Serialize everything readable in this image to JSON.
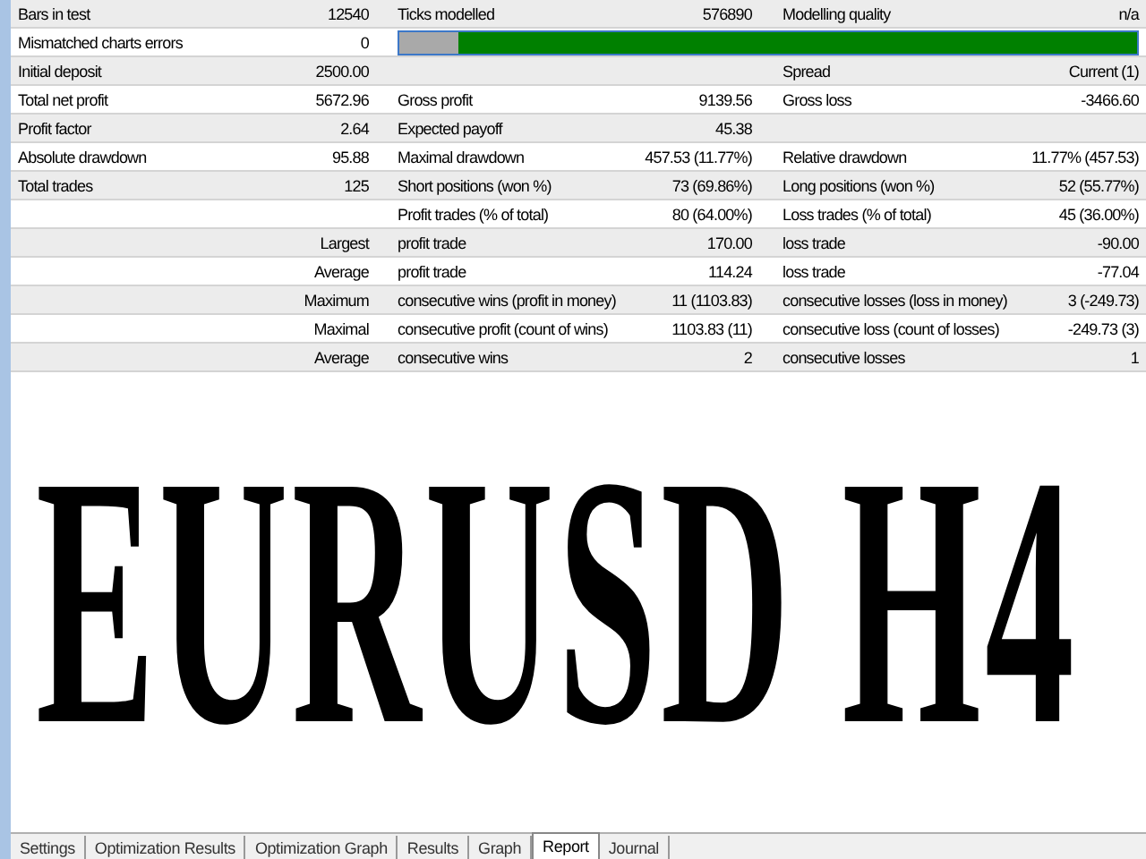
{
  "report": {
    "rows": [
      {
        "label_1": "Bars in test",
        "value_1": "12540",
        "label_2": "Ticks modelled",
        "value_2": "576890",
        "label_3": "Modelling quality",
        "value_3": "n/a"
      },
      {
        "label_1": "Mismatched charts errors",
        "value_1": "0",
        "progress": {
          "level": 0.92
        }
      },
      {
        "label_1": "Initial deposit",
        "value_1": "2500.00",
        "label_3": "Spread",
        "value_3": "Current (1)"
      },
      {
        "label_1": "Total net profit",
        "value_1": "5672.96",
        "label_2": "Gross profit",
        "value_2": "9139.56",
        "label_3": "Gross loss",
        "value_3": "-3466.60"
      },
      {
        "label_1": "Profit factor",
        "value_1": "2.64",
        "label_2": "Expected payoff",
        "value_2": "45.38"
      },
      {
        "label_1": "Absolute drawdown",
        "value_1": "95.88",
        "label_2": "Maximal drawdown",
        "value_2": "457.53 (11.77%)",
        "label_3": "Relative drawdown",
        "value_3": "11.77% (457.53)"
      },
      {
        "label_1": "Total trades",
        "value_1": "125",
        "label_2": "Short positions (won %)",
        "value_2": "73 (69.86%)",
        "label_3": "Long positions (won %)",
        "value_3": "52 (55.77%)"
      },
      {
        "label_2": "Profit trades (% of total)",
        "value_2": "80 (64.00%)",
        "label_3": "Loss trades (% of total)",
        "value_3": "45 (36.00%)"
      },
      {
        "value_1": "Largest",
        "label_2": "profit trade",
        "value_2": "170.00",
        "label_3": "loss trade",
        "value_3": "-90.00"
      },
      {
        "value_1": "Average",
        "label_2": "profit trade",
        "value_2": "114.24",
        "label_3": "loss trade",
        "value_3": "-77.04"
      },
      {
        "value_1": "Maximum",
        "label_2": "consecutive wins (profit in money)",
        "value_2": "11 (1103.83)",
        "label_3": "consecutive losses (loss in money)",
        "value_3": "3 (-249.73)"
      },
      {
        "value_1": "Maximal",
        "label_2": "consecutive profit (count of wins)",
        "value_2": "1103.83 (11)",
        "label_3": "consecutive loss (count of losses)",
        "value_3": "-249.73 (3)"
      },
      {
        "value_1": "Average",
        "label_2": "consecutive wins",
        "value_2": "2",
        "label_3": "consecutive losses",
        "value_3": "1"
      }
    ]
  },
  "overlay_title": "EURUSD H4",
  "tabs": [
    {
      "label": "Settings",
      "selected": false
    },
    {
      "label": "Optimization Results",
      "selected": false
    },
    {
      "label": "Optimization Graph",
      "selected": false
    },
    {
      "label": "Results",
      "selected": false
    },
    {
      "label": "Graph",
      "selected": false
    },
    {
      "label": "Report",
      "selected": true
    },
    {
      "label": "Journal",
      "selected": false
    }
  ]
}
